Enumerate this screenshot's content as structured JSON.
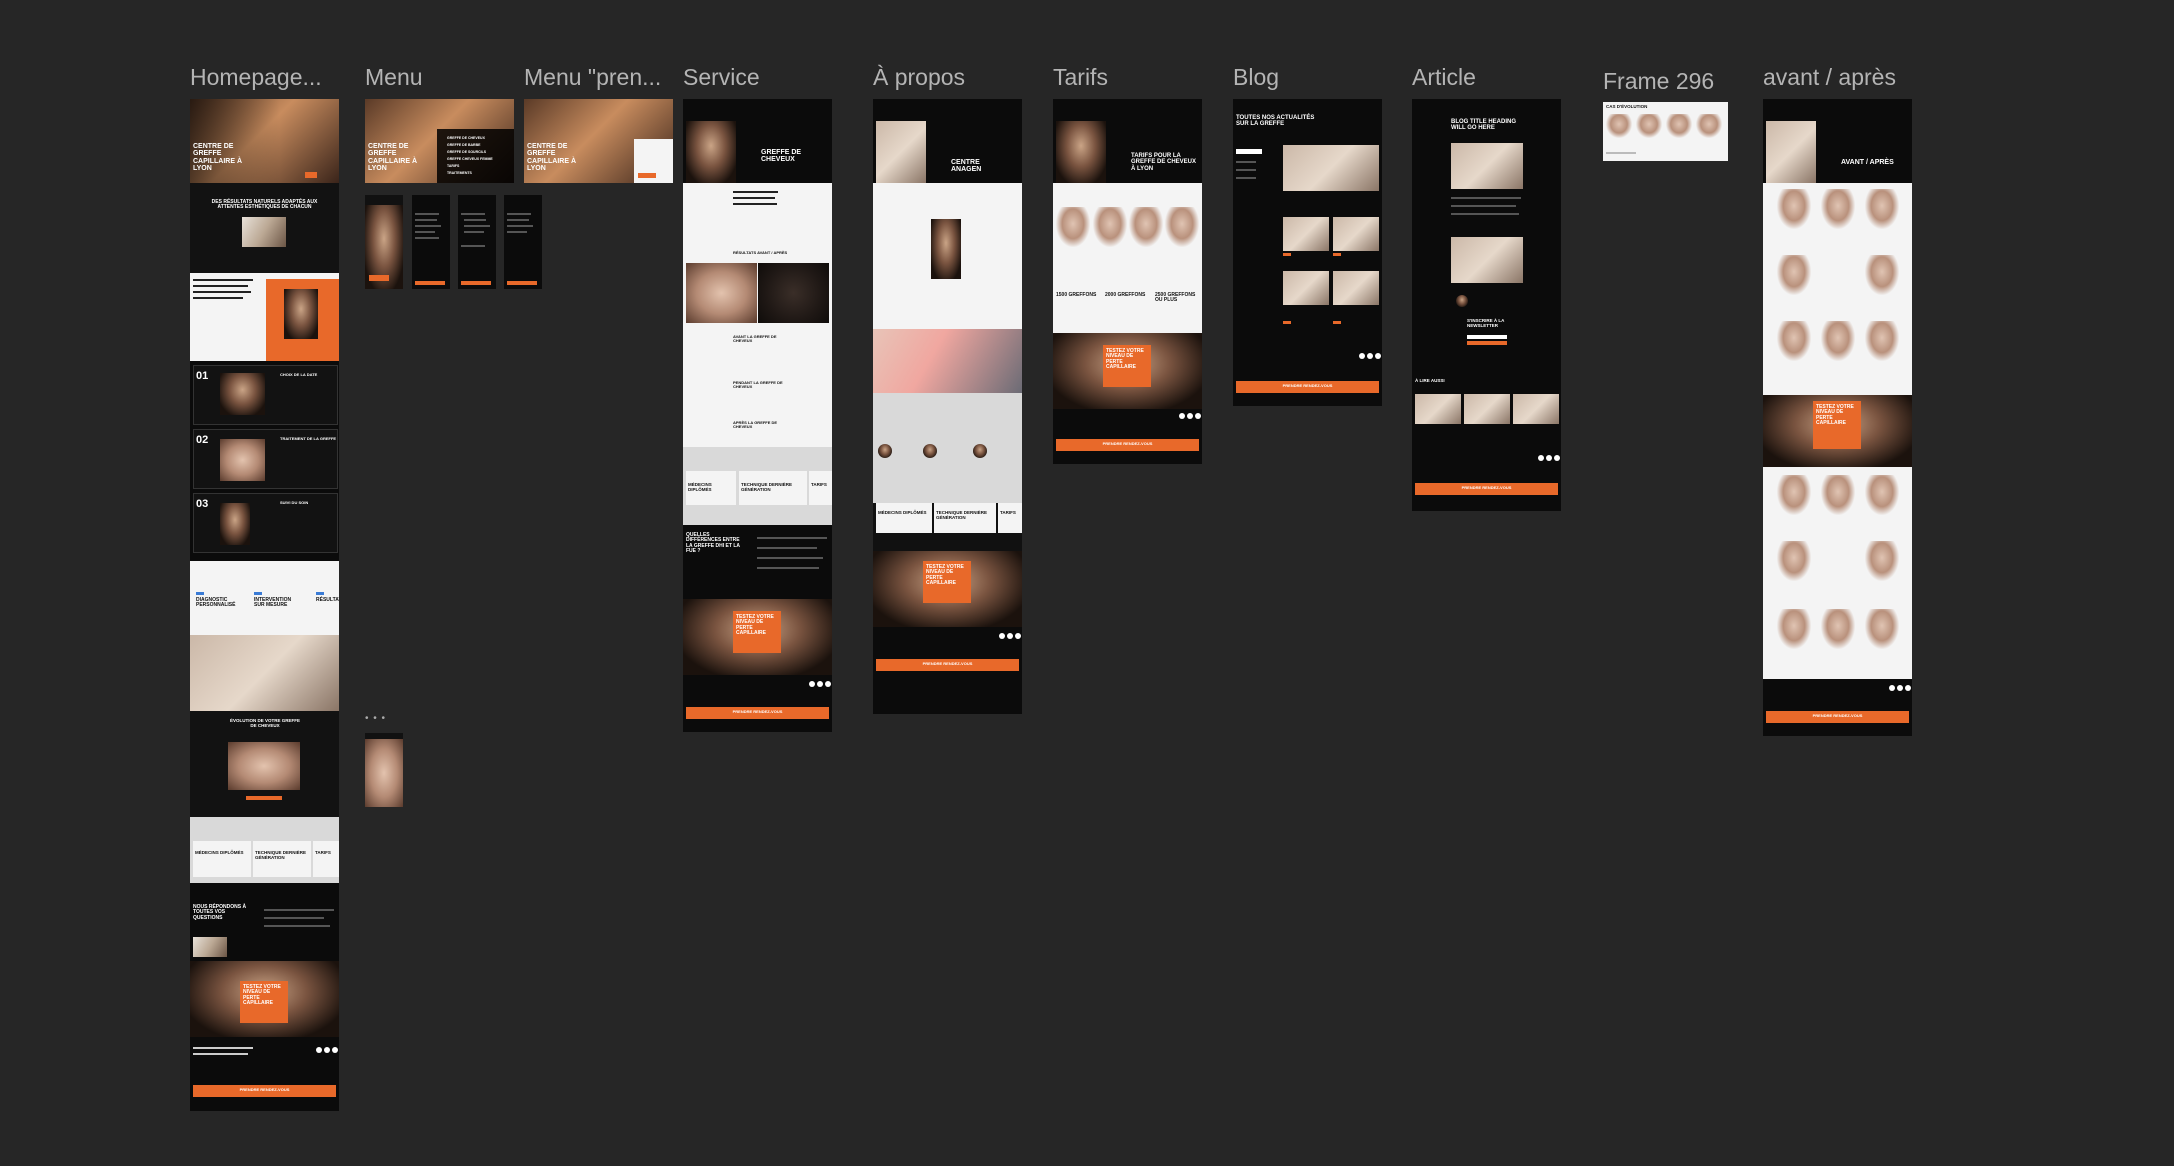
{
  "frames": [
    {
      "id": "homepage",
      "label": "Homepage..."
    },
    {
      "id": "menu",
      "label": "Menu"
    },
    {
      "id": "menu-pren",
      "label": "Menu \"pren..."
    },
    {
      "id": "service",
      "label": "Service"
    },
    {
      "id": "apropos",
      "label": "À propos"
    },
    {
      "id": "tarifs",
      "label": "Tarifs"
    },
    {
      "id": "blog",
      "label": "Blog"
    },
    {
      "id": "article",
      "label": "Article"
    },
    {
      "id": "frame296",
      "label": "Frame 296"
    },
    {
      "id": "avant-apres",
      "label": "avant / après"
    }
  ],
  "homepage": {
    "hero_title": "CENTRE DE GREFFE CAPILLAIRE À LYON",
    "section_title": "DES RÉSULTATS NATURELS ADAPTÉS AUX ATTENTES ESTHÉTIQUES DE CHACUN",
    "steps": [
      {
        "num": "01",
        "label": "CHOIX DE LA DATE"
      },
      {
        "num": "02",
        "label": "TRAITEMENT DE LA GREFFE"
      },
      {
        "num": "03",
        "label": "SUIVI DU SOIN"
      }
    ],
    "features": [
      "DIAGNOSTIC PERSONNALISÉ",
      "INTERVENTION SUR MESURE",
      "RÉSULTATS"
    ],
    "evolution_title": "ÉVOLUTION DE VOTRE GREFFE DE CHEVEUX",
    "tech_cards": [
      "MÉDECINS DIPLÔMÉS",
      "TECHNIQUE DERNIÈRE GÉNÉRATION",
      "TARIFS"
    ],
    "faq_title": "NOUS RÉPONDONS À TOUTES VOS QUESTIONS",
    "cta_title": "TESTEZ VOTRE NIVEAU DE PERTE CAPILLAIRE",
    "cta_button": "PRENDRE RENDEZ-VOUS"
  },
  "menu": {
    "hero_title": "CENTRE DE GREFFE CAPILLAIRE À LYON",
    "items": [
      "GREFFE DE CHEVEUX",
      "GREFFE DE BARBE",
      "GREFFE DE SOURCILS",
      "GREFFE CHEVEUX FEMME",
      "TARIFS",
      "TRAITEMENTS"
    ]
  },
  "menu_pren": {
    "hero_title": "CENTRE DE GREFFE CAPILLAIRE À LYON"
  },
  "service": {
    "hero_title": "GREFFE DE CHEVEUX",
    "results_title": "RÉSULTATS AVANT / APRÈS",
    "sections": [
      "AVANT LA GREFFE DE CHEVEUX",
      "PENDANT LA GREFFE DE CHEVEUX",
      "APRÈS LA GREFFE DE CHEVEUX"
    ],
    "tech_cards": [
      "MÉDECINS DIPLÔMÉS",
      "TECHNIQUE DERNIÈRE GÉNÉRATION",
      "TARIFS"
    ],
    "faq_title": "QUELLES DIFFÉRENCES ENTRE LA GREFFE DHI ET LA FUE ?",
    "cta_title": "TESTEZ VOTRE NIVEAU DE PERTE CAPILLAIRE",
    "cta_button": "PRENDRE RENDEZ-VOUS"
  },
  "apropos": {
    "hero_title": "CENTRE ANAGEN",
    "tech_cards": [
      "MÉDECINS DIPLÔMÉS",
      "TECHNIQUE DERNIÈRE GÉNÉRATION",
      "TARIFS"
    ],
    "cta_title": "TESTEZ VOTRE NIVEAU DE PERTE CAPILLAIRE",
    "cta_button": "PRENDRE RENDEZ-VOUS"
  },
  "tarifs": {
    "hero_title": "TARIFS POUR LA GREFFE DE CHEVEUX À LYON",
    "prices": [
      "1500 GREFFONS",
      "2000 GREFFONS",
      "2500 GREFFONS OU PLUS"
    ],
    "cta_title": "TESTEZ VOTRE NIVEAU DE PERTE CAPILLAIRE",
    "cta_button": "PRENDRE RENDEZ-VOUS"
  },
  "blog": {
    "title": "TOUTES NOS ACTUALITÉS SUR LA GREFFE",
    "cta_button": "PRENDRE RENDEZ-VOUS"
  },
  "article": {
    "title": "BLOG TITLE HEADING WILL GO HERE",
    "newsletter": "S'INSCRIRE À LA NEWSLETTER",
    "related": "À LIRE AUSSI",
    "cta_button": "PRENDRE RENDEZ-VOUS"
  },
  "frame296": {
    "title": "CAS D'ÉVOLUTION"
  },
  "avant_apres": {
    "hero_title": "AVANT / APRÈS",
    "cta_title": "TESTEZ VOTRE NIVEAU DE PERTE CAPILLAIRE",
    "cta_button": "PRENDRE RENDEZ-VOUS"
  },
  "colors": {
    "canvas": "#262626",
    "frame_dark": "#111111",
    "accent": "#e8692a",
    "label": "#b4b4b4"
  }
}
